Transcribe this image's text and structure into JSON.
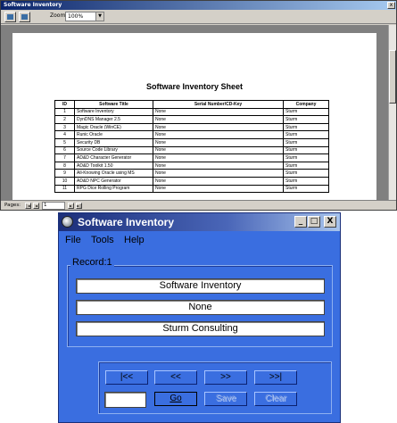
{
  "back_window": {
    "title": "Software Inventory",
    "close_glyph": "x",
    "zoom_label": "Zoom",
    "zoom_value": "100%",
    "zoom_arrow": "▼",
    "pages_label": "Pages:",
    "page_number": "1",
    "page_nav": {
      "first": "|◄",
      "prev": "◄",
      "next": "►",
      "last": "►|"
    },
    "report": {
      "title": "Software Inventory Sheet",
      "columns": [
        "ID",
        "Software Title",
        "Serial Number/CD-Key",
        "Company"
      ],
      "rows": [
        [
          "1",
          "Software Inventory",
          "None",
          "Sturm"
        ],
        [
          "2",
          "DynDNS Manager 2.5",
          "None",
          "Sturm"
        ],
        [
          "3",
          "Magic Oracle (WinCE)",
          "None",
          "Sturm"
        ],
        [
          "4",
          "Runic Oracle",
          "None",
          "Sturm"
        ],
        [
          "5",
          "Security DB",
          "None",
          "Sturm"
        ],
        [
          "6",
          "Source Code Library",
          "None",
          "Sturm"
        ],
        [
          "7",
          "AD&D Character Generator",
          "None",
          "Sturm"
        ],
        [
          "8",
          "AD&D Toolkit 1.50",
          "None",
          "Sturm"
        ],
        [
          "9",
          "All-Knowing Oracle using MS",
          "None",
          "Sturm"
        ],
        [
          "10",
          "AD&D NPC Generator",
          "None",
          "Sturm"
        ],
        [
          "11",
          "RPG Dice Rolling Program",
          "None",
          "Sturm"
        ]
      ]
    }
  },
  "front_window": {
    "title": "Software Inventory",
    "caption_buttons": {
      "minimize": "_",
      "maximize": "□",
      "close": "X"
    },
    "menu": [
      "File",
      "Tools",
      "Help"
    ],
    "record_label": "Record:1",
    "fields": {
      "software_title": "Software Inventory",
      "serial": "None",
      "company": "Sturm Consulting"
    },
    "nav_buttons": {
      "first": "|<<",
      "prev": "<<",
      "next": ">>",
      "last": ">>|"
    },
    "record_input": "",
    "actions": {
      "go": "Go",
      "save": "Save",
      "clear": "Clear"
    }
  }
}
